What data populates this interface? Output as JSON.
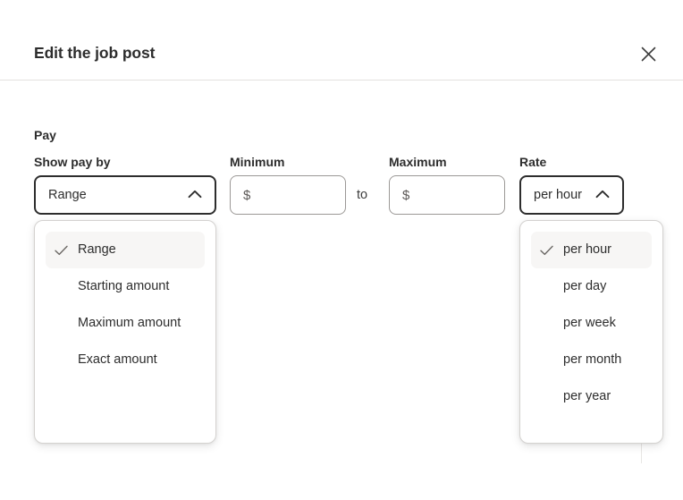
{
  "header": {
    "title": "Edit the job post",
    "close_icon": "close-icon"
  },
  "form": {
    "section_label": "Pay",
    "show_pay_by": {
      "label": "Show pay by",
      "selected": "Range",
      "chevron_icon": "chevron-up-icon",
      "expanded": true,
      "options": [
        {
          "label": "Range",
          "selected": true
        },
        {
          "label": "Starting amount",
          "selected": false
        },
        {
          "label": "Maximum amount",
          "selected": false
        },
        {
          "label": "Exact amount",
          "selected": false
        }
      ]
    },
    "minimum": {
      "label": "Minimum",
      "value": "$",
      "placeholder": "$"
    },
    "separator_text": "to",
    "maximum": {
      "label": "Maximum",
      "value": "$",
      "placeholder": "$"
    },
    "rate": {
      "label": "Rate",
      "selected": "per hour",
      "chevron_icon": "chevron-up-icon",
      "expanded": true,
      "options": [
        {
          "label": "per hour",
          "selected": true
        },
        {
          "label": "per day",
          "selected": false
        },
        {
          "label": "per week",
          "selected": false
        },
        {
          "label": "per month",
          "selected": false
        },
        {
          "label": "per year",
          "selected": false
        }
      ]
    }
  },
  "colors": {
    "text": "#2d2d2d",
    "border_focus": "#2d2d2d",
    "border_default": "#9b9896",
    "panel_border": "#d4d2d0",
    "option_selected_bg": "#f7f6f5",
    "divider": "#e4e2e0"
  }
}
